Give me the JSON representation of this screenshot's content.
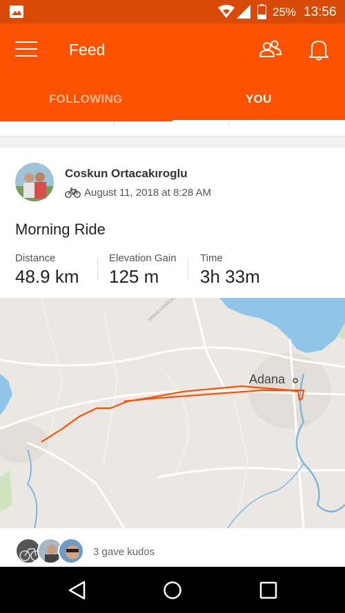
{
  "status_bar": {
    "battery": "25%",
    "time": "13:56",
    "icons": [
      "gallery-icon",
      "wifi-icon",
      "signal-icon",
      "battery-icon"
    ]
  },
  "header": {
    "title": "Feed",
    "tabs": [
      {
        "label": "FOLLOWING",
        "selected": false
      },
      {
        "label": "YOU",
        "selected": true
      }
    ],
    "icons": [
      "menu-icon",
      "people-icon",
      "bell-icon"
    ]
  },
  "activity": {
    "athlete": "Coskun Ortacakıroglu",
    "date": "August 11, 2018 at 8:28 AM",
    "type_icon": "bike-icon",
    "title": "Morning Ride",
    "stats": [
      {
        "label": "Distance",
        "value": "48.9 km"
      },
      {
        "label": "Elevation Gain",
        "value": "125 m"
      },
      {
        "label": "Time",
        "value": "3h 33m"
      }
    ],
    "map": {
      "city": "Adana",
      "watermark": "www.ceskuncoban.com",
      "route_color": "#fc5200"
    },
    "kudos": {
      "text": "3 gave kudos",
      "avatars": 3
    }
  },
  "nav": {
    "icons": [
      "back-icon",
      "home-icon",
      "recents-icon"
    ]
  },
  "colors": {
    "brand": "#fc5200",
    "status_bar": "#d94a07"
  }
}
